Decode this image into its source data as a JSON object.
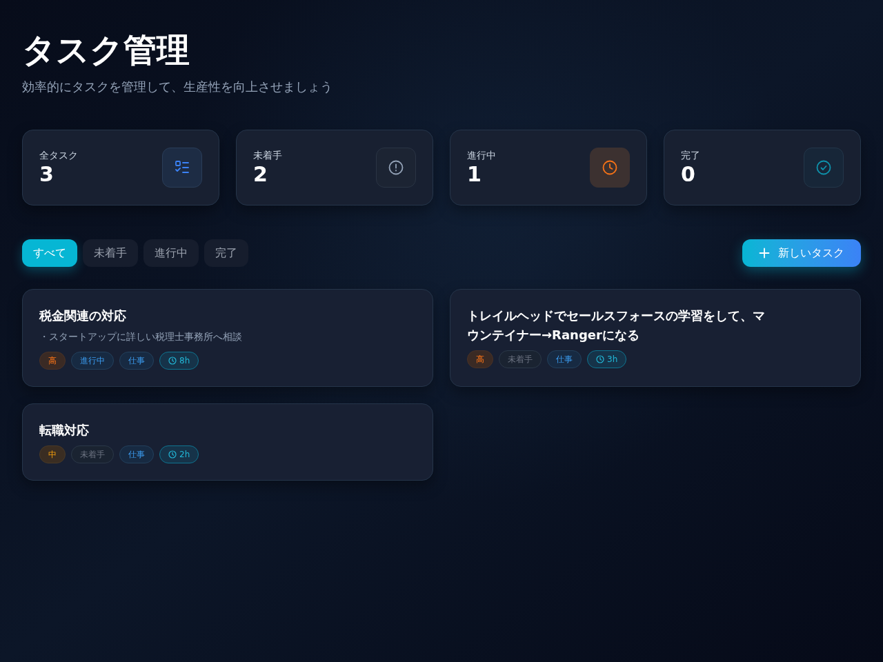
{
  "header": {
    "title": "タスク管理",
    "subtitle": "効率的にタスクを管理して、生産性を向上させましょう"
  },
  "stats": [
    {
      "label": "全タスク",
      "value": "3",
      "kind": "total"
    },
    {
      "label": "未着手",
      "value": "2",
      "kind": "not_started"
    },
    {
      "label": "進行中",
      "value": "1",
      "kind": "in_progress"
    },
    {
      "label": "完了",
      "value": "0",
      "kind": "done"
    }
  ],
  "filters": [
    {
      "label": "すべて",
      "selected": true
    },
    {
      "label": "未着手",
      "selected": false
    },
    {
      "label": "進行中",
      "selected": false
    },
    {
      "label": "完了",
      "selected": false
    }
  ],
  "new_task_button": {
    "label": "新しいタスク"
  },
  "tasks": [
    {
      "title": "税金関連の対応",
      "description": "・スタートアップに詳しい税理士事務所へ相談",
      "priority": {
        "label": "高",
        "kind": "high"
      },
      "status": {
        "label": "進行中",
        "kind": "in_progress"
      },
      "category": "仕事",
      "estimate": "8h"
    },
    {
      "title": "トレイルヘッドでセールスフォースの学習をして、マウンテイナー→Rangerになる",
      "priority": {
        "label": "高",
        "kind": "high"
      },
      "status": {
        "label": "未着手",
        "kind": "not_started"
      },
      "category": "仕事",
      "estimate": "3h"
    },
    {
      "title": "転職対応",
      "priority": {
        "label": "中",
        "kind": "medium"
      },
      "status": {
        "label": "未着手",
        "kind": "not_started"
      },
      "category": "仕事",
      "estimate": "2h"
    }
  ]
}
